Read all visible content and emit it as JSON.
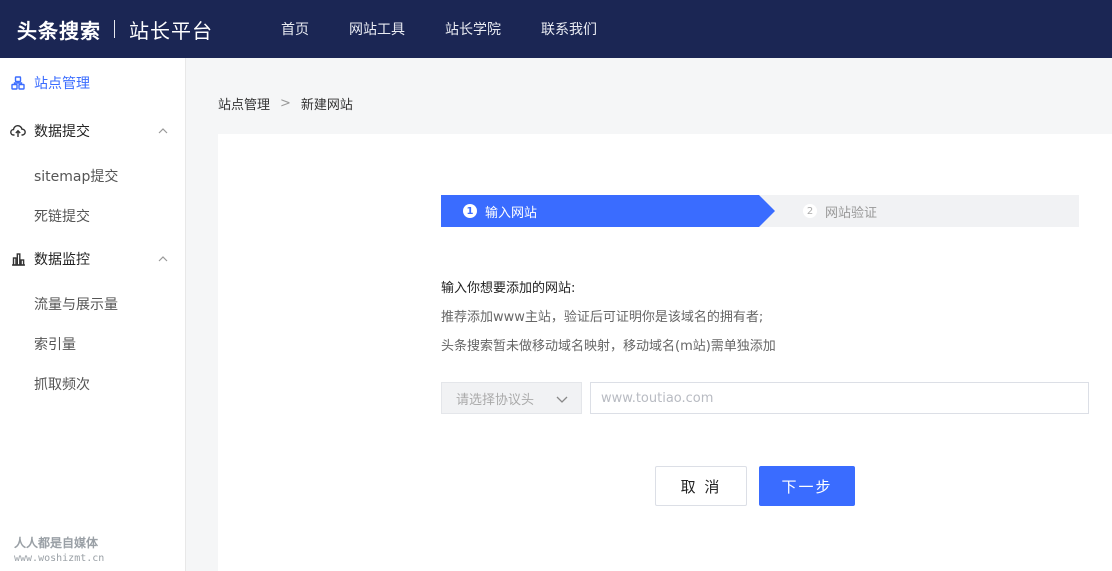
{
  "header": {
    "brand_name": "头条搜索",
    "brand_sub": "站长平台",
    "nav": [
      "首页",
      "网站工具",
      "站长学院",
      "联系我们"
    ]
  },
  "sidebar": {
    "items": [
      {
        "label": "站点管理",
        "icon": "site-manage-icon",
        "active": true
      },
      {
        "label": "数据提交",
        "icon": "upload-cloud-icon",
        "expanded": true,
        "children": [
          "sitemap提交",
          "死链提交"
        ]
      },
      {
        "label": "数据监控",
        "icon": "bar-chart-icon",
        "expanded": true,
        "children": [
          "流量与展示量",
          "索引量",
          "抓取频次"
        ]
      }
    ]
  },
  "breadcrumb": {
    "items": [
      "站点管理",
      "新建网站"
    ],
    "separator": ">"
  },
  "steps": {
    "items": [
      {
        "number": "1",
        "label": "输入网站",
        "active": true
      },
      {
        "number": "2",
        "label": "网站验证",
        "active": false
      }
    ]
  },
  "instructions": {
    "title": "输入你想要添加的网站:",
    "line1": "推荐添加www主站，验证后可证明你是该域名的拥有者;",
    "line2": "头条搜索暂未做移动域名映射，移动域名(m站)需单独添加"
  },
  "form": {
    "protocol_placeholder": "请选择协议头",
    "url_placeholder": "www.toutiao.com",
    "url_value": ""
  },
  "buttons": {
    "cancel": "取 消",
    "next": "下一步"
  },
  "watermark": {
    "line1": "人人都是自媒体",
    "line2": "www.woshizmt.cn"
  },
  "colors": {
    "header_bg": "#1b2654",
    "accent": "#3a6cff",
    "step_inactive_bg": "#f1f2f4"
  }
}
